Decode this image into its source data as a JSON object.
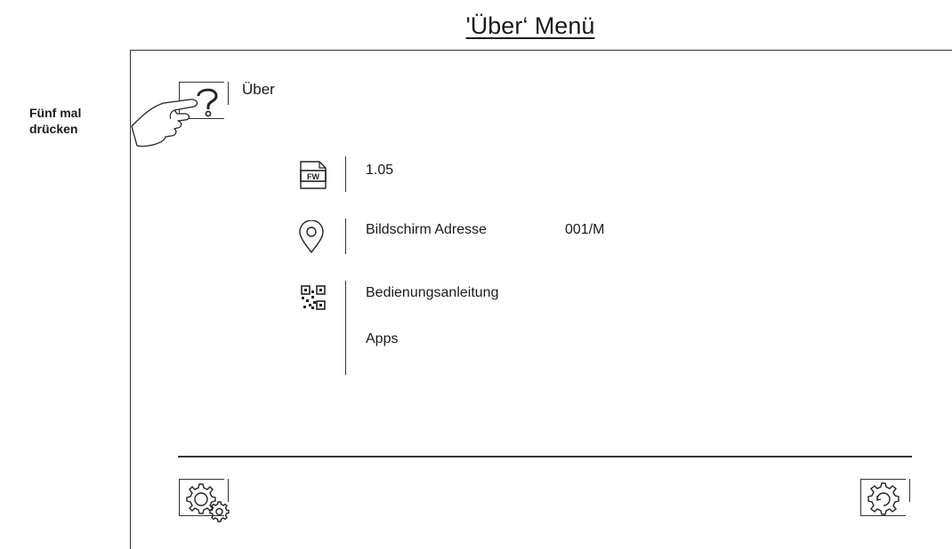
{
  "header": {
    "title": "'Über‘ Menü"
  },
  "instruction": {
    "text": "Fünf mal drücken"
  },
  "about_button": {
    "label": "Über",
    "icon": "question-mark-icon"
  },
  "firmware": {
    "icon": "fw-file-icon",
    "icon_text": "FW",
    "version": "1.05"
  },
  "address": {
    "icon": "location-pin-icon",
    "label": "Bildschirm Adresse",
    "value": "001/M"
  },
  "manual": {
    "icon": "qr-code-icon",
    "label": "Bedienungsanleitung",
    "apps_label": "Apps"
  },
  "footer": {
    "left_icon": "settings-gears-icon",
    "right_icon": "reset-gear-icon"
  }
}
